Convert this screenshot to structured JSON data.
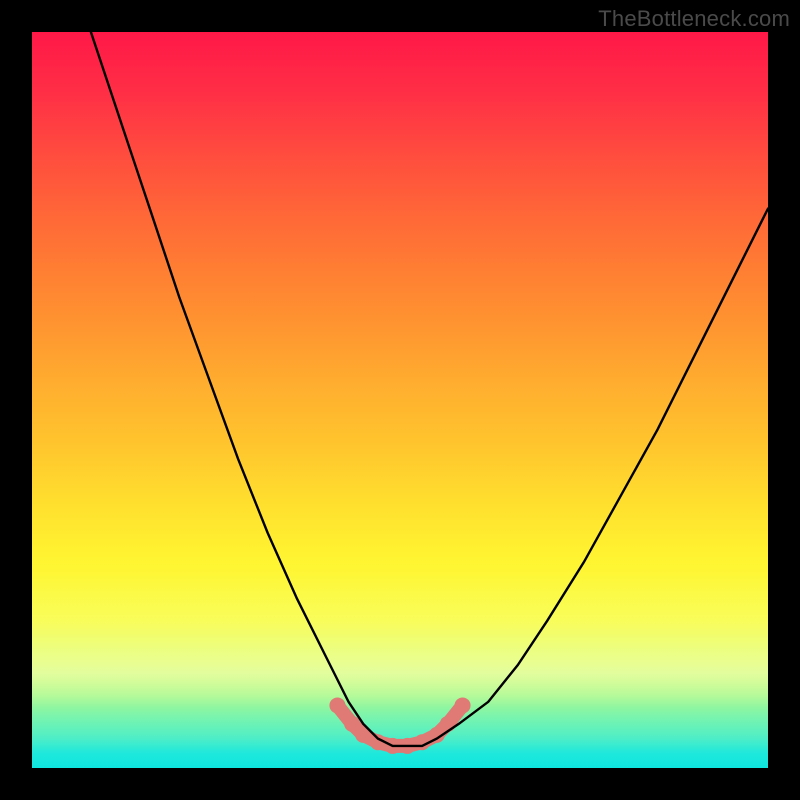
{
  "watermark": "TheBottleneck.com",
  "chart_data": {
    "type": "line",
    "title": "",
    "xlabel": "",
    "ylabel": "",
    "xlim": [
      0,
      100
    ],
    "ylim": [
      0,
      100
    ],
    "grid": false,
    "series": [
      {
        "name": "bottleneck-curve",
        "x": [
          8,
          12,
          16,
          20,
          24,
          28,
          32,
          36,
          40,
          43,
          45,
          47,
          49,
          51,
          53,
          55,
          58,
          62,
          66,
          70,
          75,
          80,
          85,
          90,
          95,
          100
        ],
        "values": [
          100,
          88,
          76,
          64,
          53,
          42,
          32,
          23,
          15,
          9,
          6,
          4,
          3,
          3,
          3,
          4,
          6,
          9,
          14,
          20,
          28,
          37,
          46,
          56,
          66,
          76
        ]
      }
    ],
    "markers": {
      "name": "highlight-points",
      "x": [
        41.5,
        43.5,
        45,
        47,
        49,
        51,
        53,
        55,
        56.5,
        58.5
      ],
      "values": [
        8.5,
        6,
        4.5,
        3.5,
        3,
        3,
        3.5,
        4.5,
        6,
        8.5
      ],
      "color": "#e07a74"
    },
    "background_gradient": {
      "top": "#ff1847",
      "upper_mid": "#ff9530",
      "mid": "#ffdf2e",
      "lower_mid": "#d9fd68",
      "bottom": "#1ee8dc"
    }
  }
}
